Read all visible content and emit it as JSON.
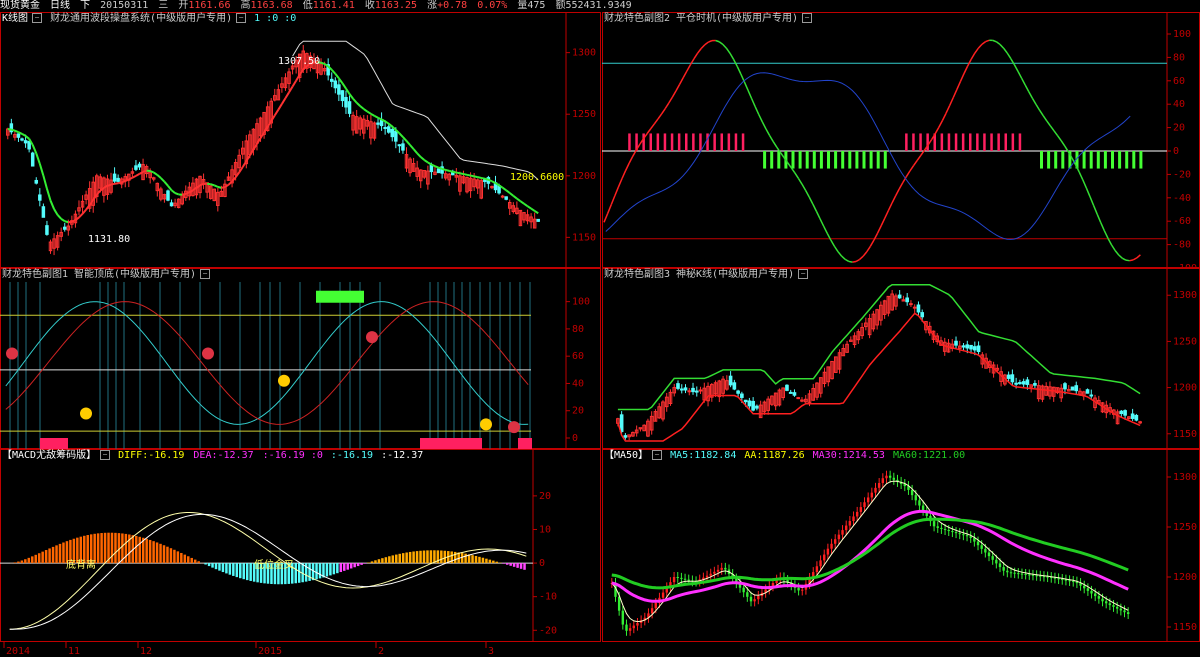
{
  "topbar": {
    "name": "现货黄金",
    "period": "日线",
    "mode": "下",
    "date": "20150311",
    "weekday": "三",
    "open_label": "开",
    "open": "1161.66",
    "high_label": "高",
    "high": "1163.68",
    "low_label": "低",
    "low": "1161.41",
    "close_label": "收",
    "close": "1163.25",
    "chg_label": "涨",
    "chg": "+0.78",
    "pct": "0.07%",
    "vol_label": "量",
    "vol": "475",
    "amt_label": "额",
    "amt": "552431.9349"
  },
  "colors": {
    "up": "#ff3232",
    "down": "#54fcfc",
    "axis": "#c00000",
    "green": "#22cc22",
    "magenta": "#ff30ff",
    "yellow": "#ffff00",
    "white": "#ffffff",
    "blue": "#2244cc"
  },
  "panels": {
    "p1": {
      "title": "K线图",
      "ind": "财龙通用波段操盘系统(中级版用户专用)",
      "params": "1 :0 :0",
      "hi_label": "1307.50",
      "lo_label": "1131.80",
      "r_label": "1200.6600",
      "ticks": [
        1300,
        1250,
        1200,
        1150
      ]
    },
    "p2": {
      "title": "财龙特色副图2 平仓时机(中级版用户专用)",
      "ticks": [
        100,
        80,
        60,
        40,
        20,
        0,
        -20,
        -40,
        -60,
        -80,
        -100
      ]
    },
    "p3": {
      "title": "财龙特色副图1 智能顶底(中级版用户专用)",
      "ticks": [
        100,
        80,
        60,
        40,
        20,
        0
      ]
    },
    "p4": {
      "title": "财龙特色副图3 神秘K线(中级版用户专用)",
      "ticks": [
        1300,
        1250,
        1200,
        1150
      ]
    },
    "p5": {
      "title": "【MACD尤敌筹码版】",
      "diff_label": "DIFF",
      "diff": ":-16.19",
      "dea_label": "DEA",
      "dea": ":-12.37",
      "v1": ":-16.19 :0",
      "v2": ":-16.19",
      "v3": ":-12.37",
      "ann1": "底背离",
      "ann2": "低位金叉",
      "ticks": [
        20,
        10,
        0,
        -10,
        -20
      ]
    },
    "p6": {
      "title": "【MA50】",
      "ma5_label": "MA5",
      "ma5": ":1182.84",
      "aa_label": "AA",
      "aa": ":1187.26",
      "ma30_label": "MA30",
      "ma30": ":1214.53",
      "ma60_label": "MA60",
      "ma60": ":1221.00",
      "ticks": [
        1300,
        1250,
        1200,
        1150
      ]
    }
  },
  "xaxis": {
    "labels": [
      "2014",
      "11",
      "12",
      "2015",
      "2",
      "3"
    ]
  },
  "chart_data": [
    {
      "type": "candlestick",
      "panel": "p1",
      "ylim": [
        1130,
        1320
      ],
      "series": [
        {
          "name": "MA",
          "type": "line"
        },
        {
          "name": "envelope",
          "type": "line"
        }
      ]
    },
    {
      "type": "line",
      "panel": "p2",
      "ylim": [
        -100,
        100
      ],
      "series": [
        {
          "name": "red/green oscillator"
        },
        {
          "name": "blue line"
        }
      ],
      "hlines": [
        75,
        0,
        -75
      ]
    },
    {
      "type": "line",
      "panel": "p3",
      "ylim": [
        0,
        110
      ],
      "hlines": [
        90,
        50,
        5
      ]
    },
    {
      "type": "candlestick",
      "panel": "p4",
      "ylim": [
        1140,
        1310
      ]
    },
    {
      "type": "bar",
      "panel": "p5",
      "ylim": [
        -22,
        28
      ],
      "series": [
        {
          "name": "DIFF"
        },
        {
          "name": "DEA"
        }
      ]
    },
    {
      "type": "candlestick",
      "panel": "p6",
      "ylim": [
        1140,
        1310
      ],
      "series": [
        {
          "name": "MA5"
        },
        {
          "name": "AA"
        },
        {
          "name": "MA30"
        },
        {
          "name": "MA60"
        }
      ]
    }
  ]
}
